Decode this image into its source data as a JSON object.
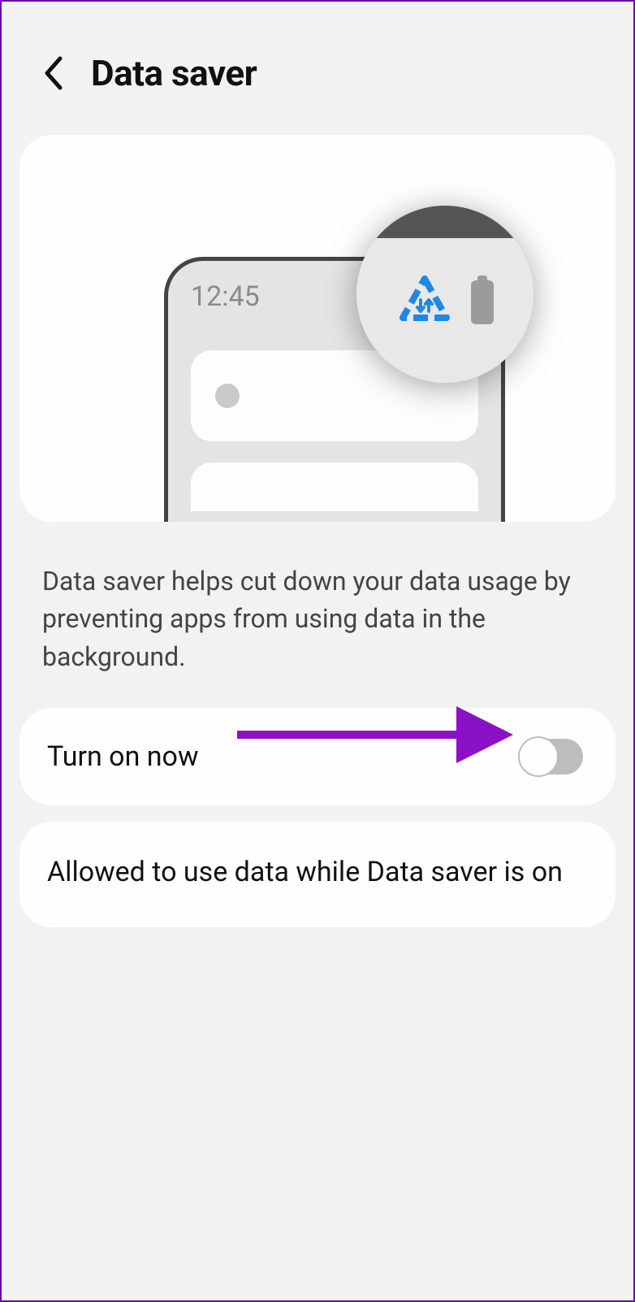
{
  "header": {
    "title": "Data saver"
  },
  "illustration": {
    "clock": "12:45"
  },
  "description": "Data saver helps cut down your data usage by preventing apps from using data in the background.",
  "toggle": {
    "label": "Turn on now",
    "state": "off"
  },
  "allowed_row": {
    "label": "Allowed to use data while Data saver is on"
  },
  "annotation": {
    "arrow_color": "#8b11c8"
  }
}
